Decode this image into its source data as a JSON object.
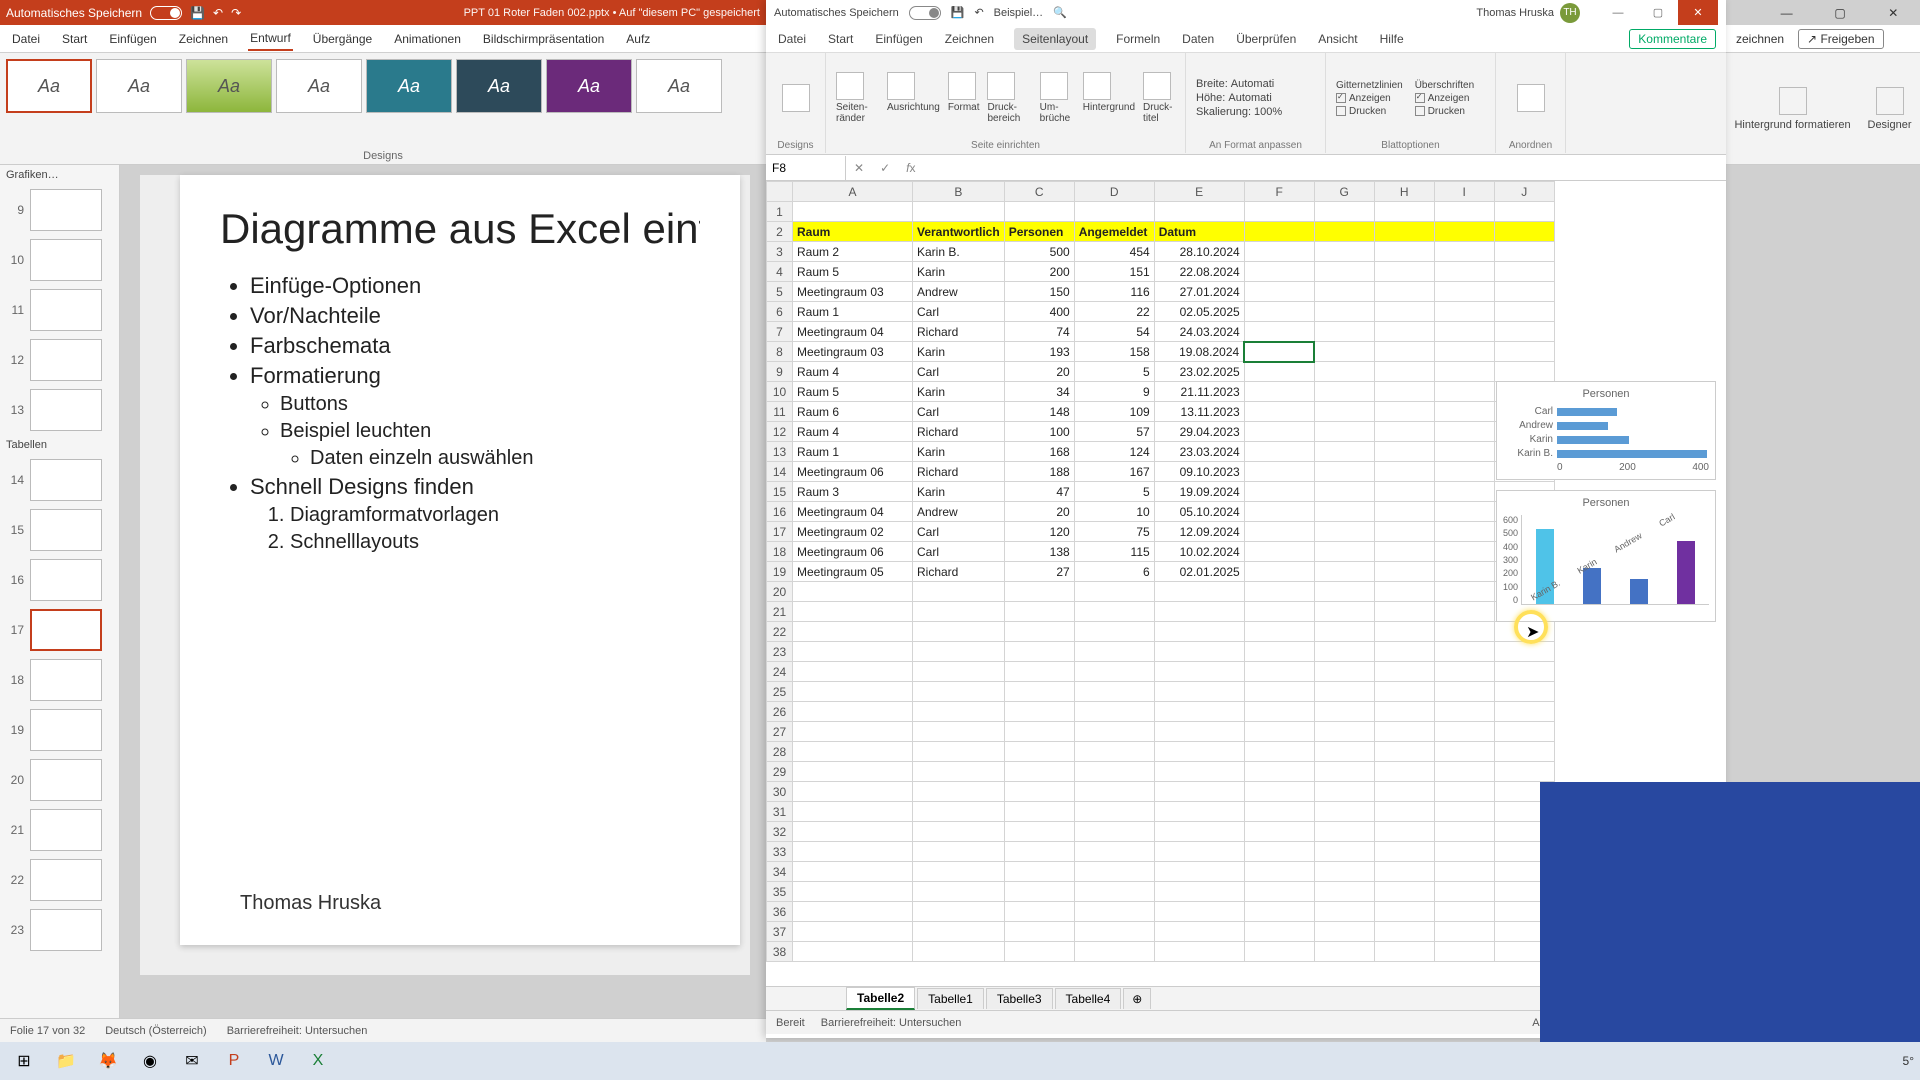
{
  "powerpoint": {
    "autosave": "Automatisches Speichern",
    "title": "PPT 01 Roter Faden 002.pptx  •  Auf \"diesem PC\" gespeichert",
    "tabs": [
      "Datei",
      "Start",
      "Einfügen",
      "Zeichnen",
      "Entwurf",
      "Übergänge",
      "Animationen",
      "Bildschirmpräsentation",
      "Aufz"
    ],
    "active_tab": "Entwurf",
    "ribbon_label": "Designs",
    "right_tabs": {
      "rec": "zeichnen",
      "share_icon": "↗",
      "share": "Freigeben"
    },
    "right_ribbon": {
      "fmt": "Hintergrund formatieren",
      "designer": "Designer"
    },
    "sections": {
      "grafiken": "Grafiken…",
      "tabellen": "Tabellen"
    },
    "slide_nums": [
      "9",
      "10",
      "11",
      "12",
      "13",
      "14",
      "15",
      "16",
      "17",
      "18",
      "19",
      "20",
      "21",
      "22",
      "23"
    ],
    "selected_slide": "17",
    "slide": {
      "title": "Diagramme aus Excel einfü",
      "b1": "Einfüge-Optionen",
      "b2": "Vor/Nachteile",
      "b3": "Farbschemata",
      "b4": "Formatierung",
      "b4a": "Buttons",
      "b4b": "Beispiel leuchten",
      "b4b1": "Daten einzeln auswählen",
      "b5": "Schnell Designs finden",
      "b5_1": "Diagramformatvorlagen",
      "b5_2": "Schnelllayouts",
      "author": "Thomas Hruska"
    },
    "status": {
      "slide": "Folie 17 von 32",
      "lang": "Deutsch (Österreich)",
      "acc": "Barrierefreiheit: Untersuchen"
    }
  },
  "excel": {
    "autosave": "Automatisches Speichern",
    "doc": "Beispiel…",
    "user": "Thomas Hruska",
    "initials": "TH",
    "tabs": [
      "Datei",
      "Start",
      "Einfügen",
      "Zeichnen",
      "Seitenlayout",
      "Formeln",
      "Daten",
      "Überprüfen",
      "Ansicht",
      "Hilfe"
    ],
    "active_tab": "Seitenlayout",
    "comments": "Kommentare",
    "ribbon": {
      "designs": "Designs",
      "seiten": "Seiten-ränder",
      "ausrich": "Ausrichtung",
      "format": "Format",
      "druckb": "Druck-bereich",
      "umbr": "Um-brüche",
      "hgrund": "Hintergrund",
      "drtitel": "Druck-titel",
      "grp_page": "Seite einrichten",
      "breite": "Breite:",
      "hoehe": "Höhe:",
      "skal": "Skalierung:",
      "auto": "Automati",
      "hundred": "100%",
      "grp_fit": "An Format anpassen",
      "gitter": "Gitternetzlinien",
      "ueber": "Überschriften",
      "anz": "Anzeigen",
      "druck": "Drucken",
      "grp_sheet": "Blattoptionen",
      "anordnen": "Anordnen"
    },
    "namebox": "F8",
    "cols": [
      "A",
      "B",
      "C",
      "D",
      "E",
      "F",
      "G",
      "H",
      "I",
      "J"
    ],
    "header": {
      "A": "Raum",
      "B": "Verantwortlich",
      "C": "Personen",
      "D": "Angemeldet",
      "E": "Datum"
    },
    "rows": [
      {
        "n": "3",
        "A": "Raum 2",
        "B": "Karin B.",
        "C": "500",
        "D": "454",
        "E": "28.10.2024"
      },
      {
        "n": "4",
        "A": "Raum 5",
        "B": "Karin",
        "C": "200",
        "D": "151",
        "E": "22.08.2024"
      },
      {
        "n": "5",
        "A": "Meetingraum 03",
        "B": "Andrew",
        "C": "150",
        "D": "116",
        "E": "27.01.2024"
      },
      {
        "n": "6",
        "A": "Raum 1",
        "B": "Carl",
        "C": "400",
        "D": "22",
        "E": "02.05.2025"
      },
      {
        "n": "7",
        "A": "Meetingraum 04",
        "B": "Richard",
        "C": "74",
        "D": "54",
        "E": "24.03.2024"
      },
      {
        "n": "8",
        "A": "Meetingraum 03",
        "B": "Karin",
        "C": "193",
        "D": "158",
        "E": "19.08.2024"
      },
      {
        "n": "9",
        "A": "Raum 4",
        "B": "Carl",
        "C": "20",
        "D": "5",
        "E": "23.02.2025"
      },
      {
        "n": "10",
        "A": "Raum 5",
        "B": "Karin",
        "C": "34",
        "D": "9",
        "E": "21.11.2023"
      },
      {
        "n": "11",
        "A": "Raum 6",
        "B": "Carl",
        "C": "148",
        "D": "109",
        "E": "13.11.2023"
      },
      {
        "n": "12",
        "A": "Raum 4",
        "B": "Richard",
        "C": "100",
        "D": "57",
        "E": "29.04.2023"
      },
      {
        "n": "13",
        "A": "Raum 1",
        "B": "Karin",
        "C": "168",
        "D": "124",
        "E": "23.03.2024"
      },
      {
        "n": "14",
        "A": "Meetingraum 06",
        "B": "Richard",
        "C": "188",
        "D": "167",
        "E": "09.10.2023"
      },
      {
        "n": "15",
        "A": "Raum 3",
        "B": "Karin",
        "C": "47",
        "D": "5",
        "E": "19.09.2024"
      },
      {
        "n": "16",
        "A": "Meetingraum 04",
        "B": "Andrew",
        "C": "20",
        "D": "10",
        "E": "05.10.2024"
      },
      {
        "n": "17",
        "A": "Meetingraum 02",
        "B": "Carl",
        "C": "120",
        "D": "75",
        "E": "12.09.2024"
      },
      {
        "n": "18",
        "A": "Meetingraum 06",
        "B": "Carl",
        "C": "138",
        "D": "115",
        "E": "10.02.2024"
      },
      {
        "n": "19",
        "A": "Meetingraum 05",
        "B": "Richard",
        "C": "27",
        "D": "6",
        "E": "02.01.2025"
      }
    ],
    "empty_rows": [
      "20",
      "21",
      "22",
      "23",
      "24",
      "25",
      "26",
      "27",
      "28",
      "29",
      "30",
      "31",
      "32",
      "33",
      "34",
      "35",
      "36",
      "37",
      "38"
    ],
    "sheets": [
      "Tabelle2",
      "Tabelle1",
      "Tabelle3",
      "Tabelle4"
    ],
    "active_sheet": "Tabelle2",
    "status": {
      "ready": "Bereit",
      "acc": "Barrierefreiheit: Untersuchen",
      "disp": "Anzeigeeinstellungen"
    },
    "chart1": {
      "title": "Personen",
      "ticks": [
        "0",
        "200",
        "400"
      ]
    },
    "chart2": {
      "title": "Personen",
      "yticks": [
        "600",
        "500",
        "400",
        "300",
        "200",
        "100",
        "0"
      ]
    }
  },
  "chart_data": [
    {
      "type": "bar",
      "orientation": "horizontal",
      "title": "Personen",
      "categories": [
        "Carl",
        "Andrew",
        "Karin",
        "Karin B."
      ],
      "values": [
        200,
        170,
        240,
        500
      ],
      "xlim": [
        0,
        500
      ],
      "xticks": [
        0,
        200,
        400
      ]
    },
    {
      "type": "bar",
      "orientation": "vertical",
      "title": "Personen",
      "categories": [
        "Karin B.",
        "Karin",
        "Andrew",
        "Carl"
      ],
      "values": [
        500,
        240,
        170,
        420
      ],
      "ylim": [
        0,
        600
      ],
      "yticks": [
        0,
        100,
        200,
        300,
        400,
        500,
        600
      ],
      "colors": [
        "#4fc3e8",
        "#4472c4",
        "#4472c4",
        "#7030a0"
      ]
    }
  ],
  "taskbar": {
    "weather": "5°"
  }
}
